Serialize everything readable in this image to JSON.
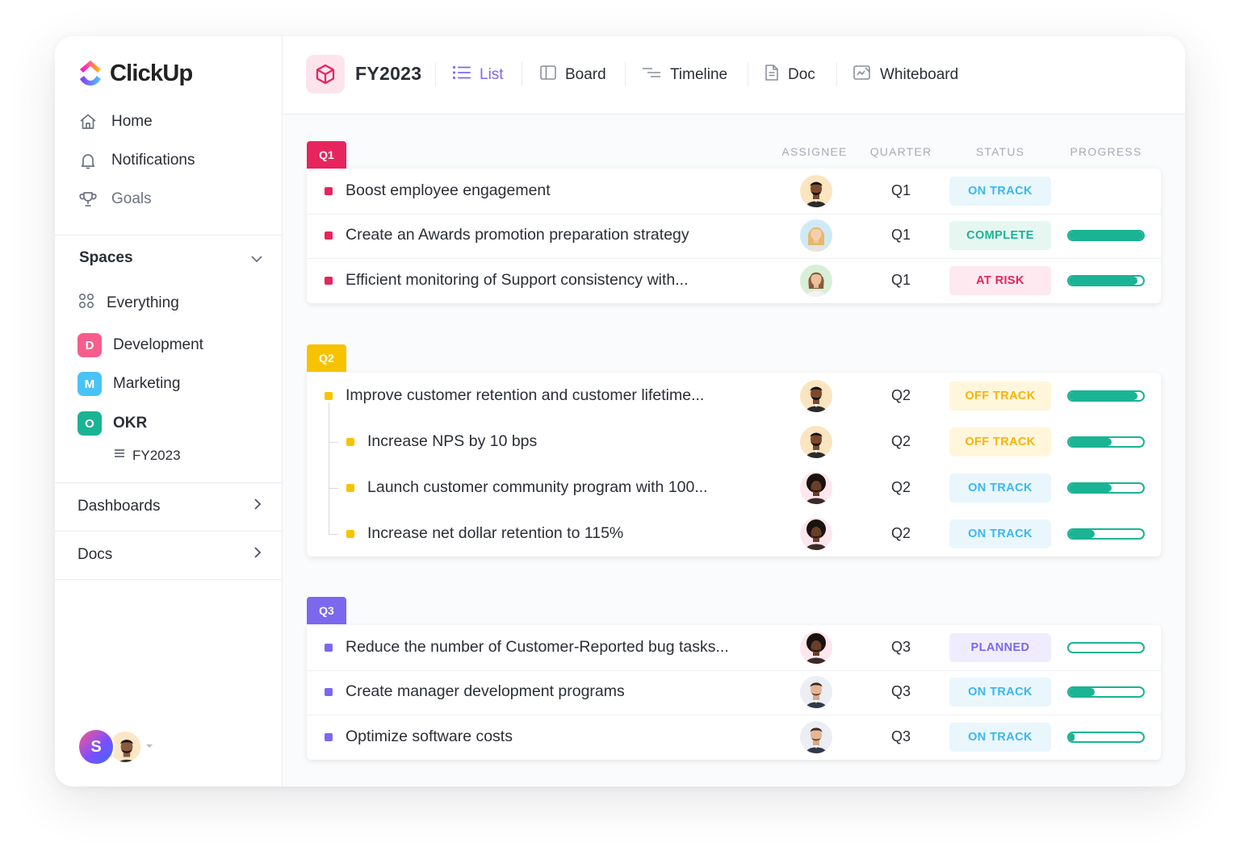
{
  "brand": {
    "name": "ClickUp"
  },
  "nav": {
    "home": "Home",
    "notifications": "Notifications",
    "goals": "Goals"
  },
  "spaces": {
    "title": "Spaces",
    "everything": "Everything",
    "items": [
      {
        "letter": "D",
        "label": "Development",
        "color": "#f2467b"
      },
      {
        "letter": "M",
        "label": "Marketing",
        "color": "#38b6f4"
      },
      {
        "letter": "O",
        "label": "OKR",
        "color": "#1ab394"
      }
    ],
    "okr_sub": "FY2023"
  },
  "sections": {
    "dashboards": "Dashboards",
    "docs": "Docs"
  },
  "user": {
    "initial": "S"
  },
  "header": {
    "title": "FY2023",
    "tabs": [
      "List",
      "Board",
      "Timeline",
      "Doc",
      "Whiteboard"
    ],
    "active_tab": "List",
    "accent": "#7b68ee"
  },
  "columns": {
    "assignee": "ASSIGNEE",
    "quarter": "QUARTER",
    "status": "STATUS",
    "progress": "PROGRESS"
  },
  "groups": [
    {
      "label": "Q1",
      "color": "#e7245e",
      "rows": [
        {
          "name": "Boost employee engagement",
          "avatar": "man-dark",
          "quarter": "Q1",
          "status": "ON TRACK",
          "progress": null
        },
        {
          "name": "Create an Awards promotion preparation strategy",
          "avatar": "woman-blonde",
          "quarter": "Q1",
          "status": "COMPLETE",
          "progress": 1.0
        },
        {
          "name": "Efficient monitoring of Support consistency with...",
          "avatar": "woman-brown",
          "quarter": "Q1",
          "status": "AT RISK",
          "progress": 0.92
        }
      ]
    },
    {
      "label": "Q2",
      "color": "#f7c300",
      "rows": [
        {
          "name": "Improve customer retention and customer lifetime...",
          "avatar": "man-dark",
          "quarter": "Q2",
          "status": "OFF TRACK",
          "progress": 0.92
        },
        {
          "name": "Increase NPS by 10 bps",
          "avatar": "man-dark",
          "quarter": "Q2",
          "status": "OFF TRACK",
          "progress": 0.58,
          "child": true
        },
        {
          "name": "Launch customer community program with 100...",
          "avatar": "man-afro",
          "quarter": "Q2",
          "status": "ON TRACK",
          "progress": 0.58,
          "child": true
        },
        {
          "name": "Increase net dollar retention to 115%",
          "avatar": "man-afro",
          "quarter": "Q2",
          "status": "ON TRACK",
          "progress": 0.35,
          "child": true
        }
      ]
    },
    {
      "label": "Q3",
      "color": "#7b68ee",
      "rows": [
        {
          "name": "Reduce the number of Customer-Reported bug tasks...",
          "avatar": "man-afro",
          "quarter": "Q3",
          "status": "PLANNED",
          "progress": 0.0
        },
        {
          "name": "Create manager development programs",
          "avatar": "man-light",
          "quarter": "Q3",
          "status": "ON TRACK",
          "progress": 0.35
        },
        {
          "name": "Optimize software costs",
          "avatar": "man-light",
          "quarter": "Q3",
          "status": "ON TRACK",
          "progress": 0.08
        }
      ]
    }
  ],
  "status_colors": {
    "ON TRACK": {
      "fg": "#3ab7f0",
      "bg": "#e9f7fd"
    },
    "COMPLETE": {
      "fg": "#1ab394",
      "bg": "#e6f7f2"
    },
    "AT RISK": {
      "fg": "#e7245e",
      "bg": "#fde9ef"
    },
    "OFF TRACK": {
      "fg": "#f5b400",
      "bg": "#fff6dc"
    },
    "PLANNED": {
      "fg": "#7b68ee",
      "bg": "#efedfd"
    }
  }
}
